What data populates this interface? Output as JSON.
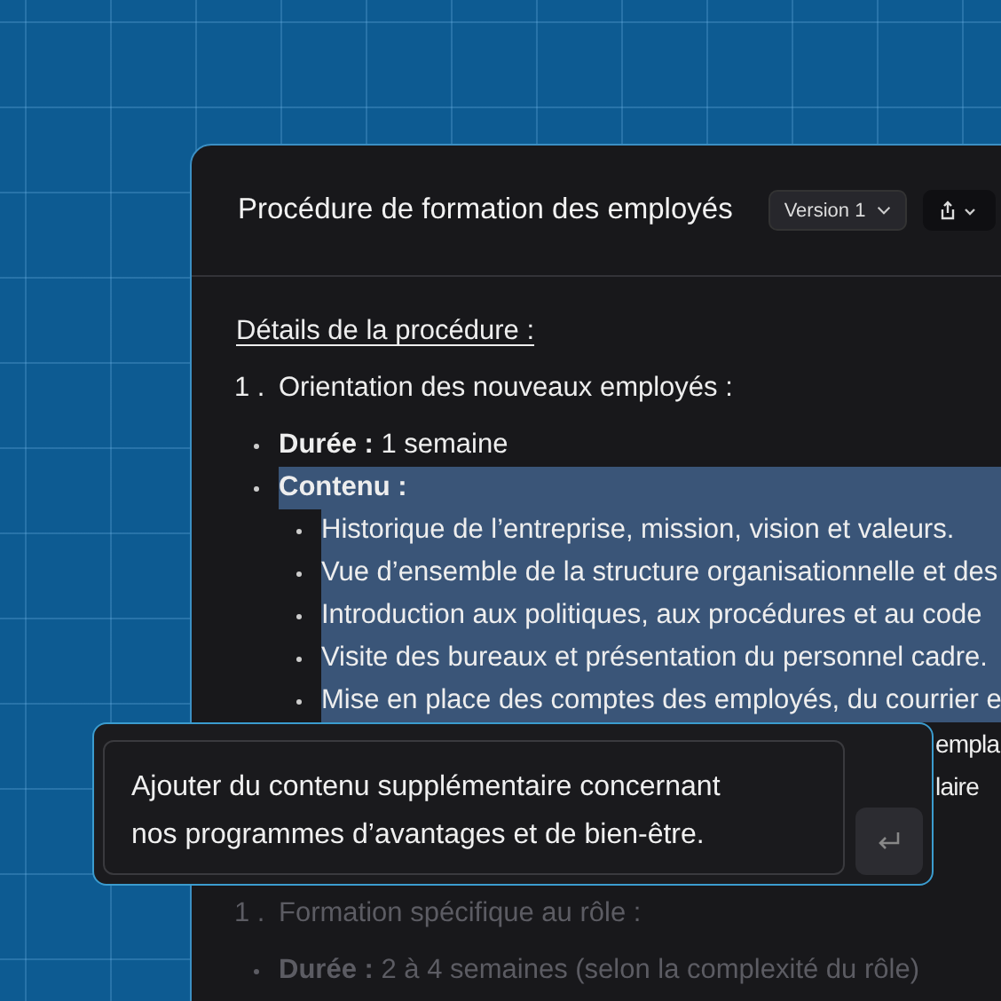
{
  "document": {
    "title": "Procédure de formation des employés",
    "version_label": "Version 1"
  },
  "lines": [
    {
      "kind": "heading",
      "text": "Détails de la procédure :",
      "selected": false,
      "dimmed": false
    },
    {
      "kind": "numbered",
      "number": "1 .",
      "text": "Orientation des nouveaux employés :",
      "selected": false,
      "dimmed": false
    },
    {
      "kind": "bullet",
      "label": "Durée :",
      "text": "1 semaine",
      "selected": false,
      "dimmed": false
    },
    {
      "kind": "bullet",
      "label": "Contenu :",
      "selected": true,
      "dimmed": false
    },
    {
      "kind": "subbullet",
      "text": "Historique de l’entreprise, mission, vision et valeurs.",
      "selected": true,
      "dimmed": false
    },
    {
      "kind": "subbullet",
      "text": "Vue d’ensemble de la structure organisationnelle et des",
      "selected": true,
      "dimmed": false
    },
    {
      "kind": "subbullet",
      "text": "Introduction aux politiques, aux procédures et au code",
      "selected": true,
      "dimmed": false
    },
    {
      "kind": "subbullet",
      "text": "Visite des bureaux et présentation du personnel cadre.",
      "selected": true,
      "dimmed": false
    },
    {
      "kind": "subbullet",
      "text": "Mise en place des comptes des employés, du courrier e",
      "selected": true,
      "dimmed": false
    },
    {
      "kind": "tail",
      "text": "empla",
      "selected": false,
      "dimmed": false
    },
    {
      "kind": "tail",
      "text": "laire",
      "selected": false,
      "dimmed": false
    },
    {
      "kind": "gap"
    },
    {
      "kind": "numbered",
      "number": "1 .",
      "text": "Formation spécifique au rôle :",
      "selected": false,
      "dimmed": true
    },
    {
      "kind": "bullet",
      "label": "Durée :",
      "text": "2 à 4 semaines (selon la complexité du rôle)",
      "selected": false,
      "dimmed": true
    }
  ],
  "prompt": {
    "value": "Ajouter du contenu supplémentaire concernant nos programmes d’avantages et de bien-être."
  }
}
